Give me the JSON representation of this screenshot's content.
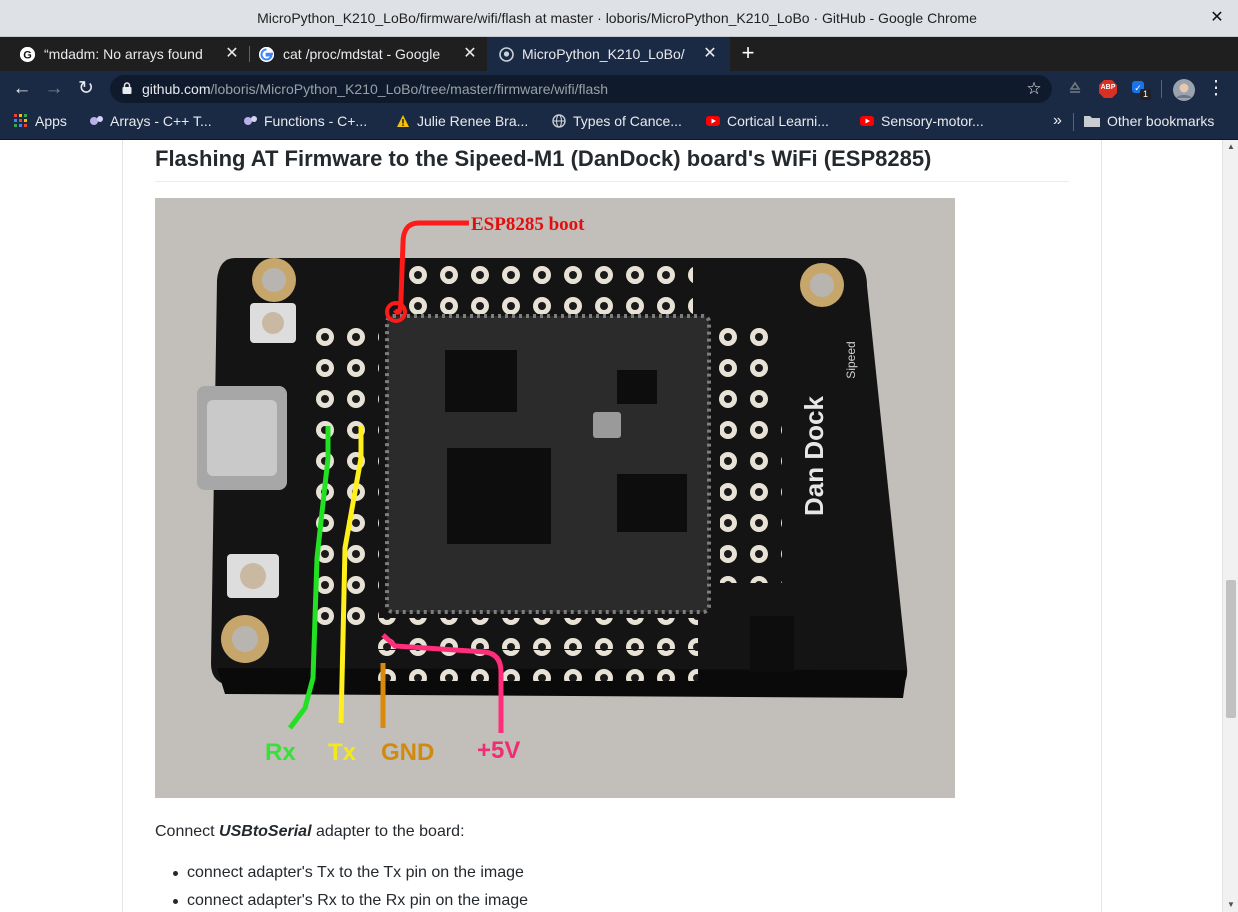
{
  "window": {
    "title": "MicroPython_K210_LoBo/firmware/wifi/flash at master · loboris/MicroPython_K210_LoBo · GitHub - Google Chrome",
    "close_glyph": "✕"
  },
  "tabs": [
    {
      "label": "“mdadm: No arrays found",
      "favicon": "g-letter-icon",
      "active": false
    },
    {
      "label": "cat /proc/mdstat - Google",
      "favicon": "google-icon",
      "active": false
    },
    {
      "label": "MicroPython_K210_LoBo/",
      "favicon": "github-icon",
      "active": true
    }
  ],
  "toolbar": {
    "back": "←",
    "forward": "→",
    "reload": "↻",
    "url_host": "github.com",
    "url_path": "/loboris/MicroPython_K210_LoBo/tree/master/firmware/wifi/flash",
    "star": "☆",
    "new_tab": "+",
    "extension_badge": "1",
    "abp_label": "ABP",
    "menu": "⋮"
  },
  "bookmarks": {
    "items": [
      {
        "label": "Apps",
        "icon": "apps-grid-icon"
      },
      {
        "label": "Arrays - C++ T...",
        "icon": "cpp-icon"
      },
      {
        "label": "Functions - C+...",
        "icon": "cpp-icon"
      },
      {
        "label": "Julie Renee Bra...",
        "icon": "warning-icon"
      },
      {
        "label": "Types of Cance...",
        "icon": "globe-icon"
      },
      {
        "label": "Cortical Learni...",
        "icon": "youtube-icon"
      },
      {
        "label": "Sensory-motor...",
        "icon": "youtube-icon"
      }
    ],
    "overflow": "»",
    "other": "Other bookmarks"
  },
  "page": {
    "heading": "Flashing AT Firmware to the Sipeed-M1 (DanDock) board's WiFi (ESP8285)",
    "figure_labels": {
      "boot": "ESP8285 boot",
      "rx": "Rx",
      "tx": "Tx",
      "gnd": "GND",
      "v5": "+5V",
      "brand": "Dan Dock",
      "sub": "Sipeed"
    },
    "para_prefix": "Connect ",
    "para_em": "USBtoSerial",
    "para_suffix": " adapter to the board:",
    "list": [
      "connect adapter's Tx to the Tx pin on the image",
      "connect adapter's Rx to the Rx pin on the image"
    ]
  },
  "scrollbar": {
    "up": "▲",
    "down": "▼"
  }
}
